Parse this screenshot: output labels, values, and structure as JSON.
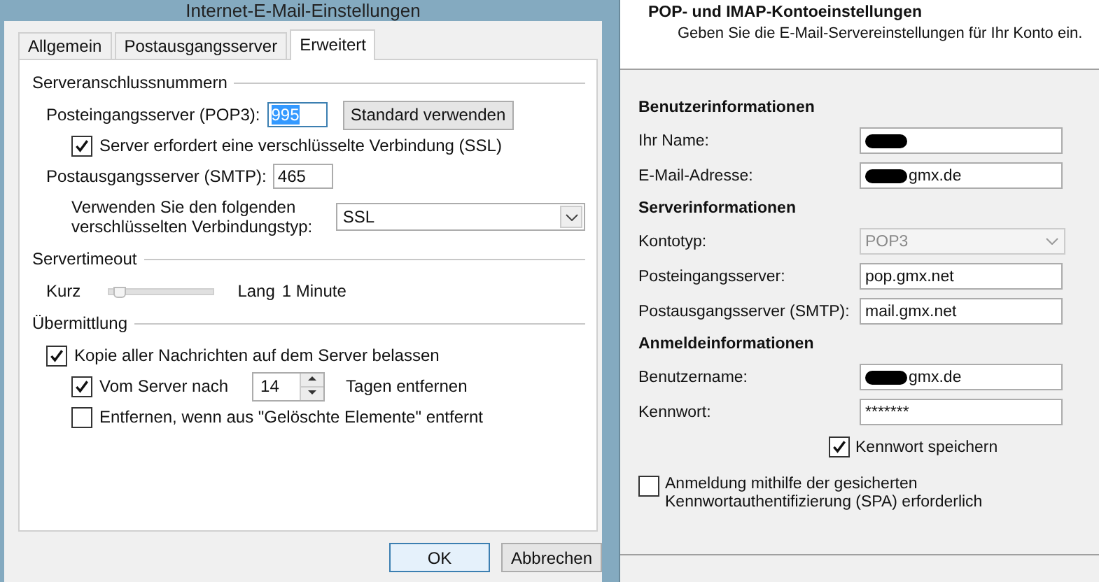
{
  "dialog": {
    "title": "Internet-E-Mail-Einstellungen",
    "tabs": [
      {
        "label": "Allgemein",
        "selected": false
      },
      {
        "label": "Postausgangsserver",
        "selected": false
      },
      {
        "label": "Erweitert",
        "selected": true
      }
    ],
    "groups": [
      {
        "heading": "Serveranschlussnummern",
        "rows": [
          {
            "kind": "port",
            "label": "Posteingangsserver (POP3):",
            "value": "995",
            "text_selected": true,
            "button": "Standard verwenden",
            "children": [
              {
                "kind": "checkbox",
                "label": "Server erfordert eine verschlüsselte Verbindung (SSL)",
                "checked": true
              }
            ]
          },
          {
            "kind": "port",
            "label": "Postausgangsserver (SMTP):",
            "value": "465",
            "text_selected": false,
            "children": [
              {
                "kind": "dropdown",
                "label": "Verwenden Sie den folgenden verschlüsselten Verbindungstyp:",
                "value": "SSL"
              }
            ]
          }
        ]
      },
      {
        "heading": "Servertimeout",
        "rows": [
          {
            "kind": "slider",
            "min_label": "Kurz",
            "max_label": "Lang",
            "level": 0.1,
            "reading": "1 Minute"
          }
        ]
      },
      {
        "heading": "Übermittlung",
        "rows": [
          {
            "kind": "checkbox",
            "label": "Kopie aller Nachrichten auf dem Server belassen",
            "checked": true,
            "children": [
              {
                "kind": "spinner",
                "label": "Vom Server nach",
                "value": "14",
                "after": "Tagen entfernen",
                "checked": true
              },
              {
                "kind": "checkbox",
                "label": "Entfernen, wenn aus \"Gelöschte Elemente\" entfernt",
                "checked": false
              }
            ]
          }
        ]
      }
    ],
    "buttons": [
      {
        "label": "OK",
        "default": true
      },
      {
        "label": "Abbrechen",
        "default": false
      }
    ]
  },
  "account": {
    "title": "POP- und IMAP-Kontoeinstellungen",
    "subtitle": "Geben Sie die E-Mail-Servereinstellungen für Ihr Konto ein.",
    "sections": [
      {
        "heading": "Benutzerinformationen",
        "rows": [
          {
            "kind": "text",
            "label": "Ihr Name:",
            "redacted": true
          },
          {
            "kind": "text",
            "label": "E-Mail-Adresse:",
            "value": "gmx.de",
            "redacted": true
          }
        ]
      },
      {
        "heading": "Serverinformationen",
        "rows": [
          {
            "kind": "dropdown",
            "label": "Kontotyp:",
            "value": "POP3",
            "disabled": true
          },
          {
            "kind": "text",
            "label": "Posteingangsserver:",
            "value": "pop.gmx.net"
          },
          {
            "kind": "text",
            "label": "Postausgangsserver (SMTP):",
            "value": "mail.gmx.net"
          }
        ]
      },
      {
        "heading": "Anmeldeinformationen",
        "rows": [
          {
            "kind": "text",
            "label": "Benutzername:",
            "value": "gmx.de",
            "redacted": true
          },
          {
            "kind": "text",
            "label": "Kennwort:",
            "value": "*******"
          },
          {
            "kind": "checkbox",
            "label": "Kennwort speichern",
            "checked": true
          }
        ]
      }
    ],
    "spa": {
      "label": "Anmeldung mithilfe der gesicherten Kennwortauthentifizierung (SPA) erforderlich",
      "checked": false
    }
  }
}
